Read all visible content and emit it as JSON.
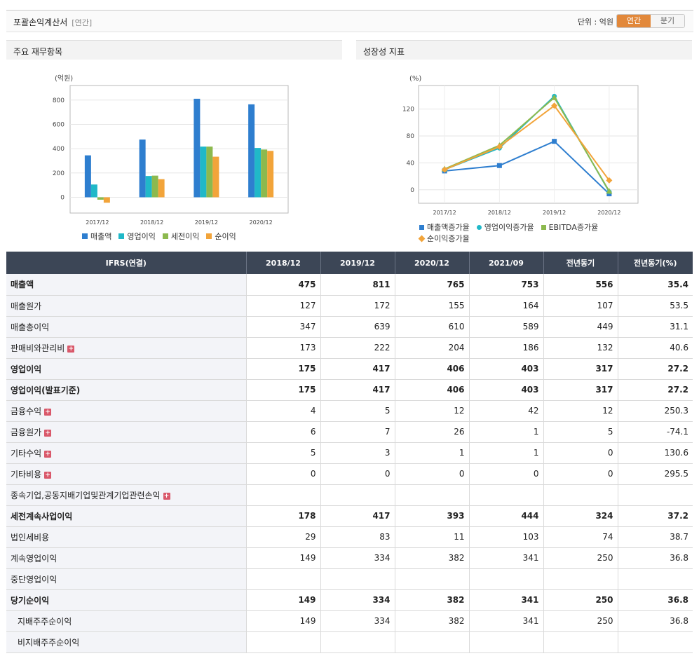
{
  "header": {
    "title": "포괄손익계산서",
    "period": "[연간]",
    "unit_label": "단위 : 억원",
    "tabs": [
      "연간",
      "분기"
    ]
  },
  "panels": {
    "left_title": "주요 재무항목",
    "right_title": "성장성 지표"
  },
  "colors": {
    "revenue": "#2e7ecf",
    "op_income": "#20b8c8",
    "pretax": "#8cb94e",
    "net": "#f2a43a",
    "header_bg": "#3c4656",
    "negative": "#e32c2c"
  },
  "chart_data": [
    {
      "type": "bar",
      "title": "주요 재무항목",
      "unit": "(억원)",
      "categories": [
        "2017/12",
        "2018/12",
        "2019/12",
        "2020/12"
      ],
      "series": [
        {
          "name": "매출액",
          "values": [
            345,
            475,
            811,
            765
          ]
        },
        {
          "name": "영업이익",
          "values": [
            105,
            175,
            417,
            406
          ]
        },
        {
          "name": "세전이익",
          "values": [
            -20,
            178,
            417,
            393
          ]
        },
        {
          "name": "순이익",
          "values": [
            -45,
            149,
            334,
            382
          ]
        }
      ],
      "yticks": [
        0,
        200,
        400,
        600,
        800
      ],
      "ylim": [
        -130,
        920
      ],
      "grid": true,
      "legend": "bottom"
    },
    {
      "type": "line",
      "title": "성장성 지표",
      "unit": "(%)",
      "categories": [
        "2017/12",
        "2018/12",
        "2019/12",
        "2020/12"
      ],
      "series": [
        {
          "name": "매출액증가율",
          "values": [
            28,
            36,
            72,
            -6
          ]
        },
        {
          "name": "영업이익증가율",
          "values": [
            30,
            62,
            139,
            -3
          ]
        },
        {
          "name": "EBITDA증가율",
          "values": [
            31,
            66,
            137,
            -2
          ]
        },
        {
          "name": "순이익증가율",
          "values": [
            30,
            64,
            125,
            14
          ]
        }
      ],
      "yticks": [
        0,
        40,
        80,
        120
      ],
      "ylim": [
        -20,
        155
      ],
      "grid": true,
      "legend": "bottom"
    }
  ],
  "table": {
    "columns": [
      "IFRS(연결)",
      "2018/12",
      "2019/12",
      "2020/12",
      "2021/09",
      "전년동기",
      "전년동기(%)"
    ],
    "rows": [
      {
        "label": "매출액",
        "values": [
          "475",
          "811",
          "765",
          "753",
          "556",
          "35.4"
        ],
        "bold": true
      },
      {
        "label": "매출원가",
        "values": [
          "127",
          "172",
          "155",
          "164",
          "107",
          "53.5"
        ]
      },
      {
        "label": "매출총이익",
        "values": [
          "347",
          "639",
          "610",
          "589",
          "449",
          "31.1"
        ]
      },
      {
        "label": "판매비와관리비",
        "values": [
          "173",
          "222",
          "204",
          "186",
          "132",
          "40.6"
        ],
        "plus": true
      },
      {
        "label": "영업이익",
        "values": [
          "175",
          "417",
          "406",
          "403",
          "317",
          "27.2"
        ],
        "bold": true,
        "group": true
      },
      {
        "label": "영업이익(발표기준)",
        "values": [
          "175",
          "417",
          "406",
          "403",
          "317",
          "27.2"
        ],
        "bold": true
      },
      {
        "label": "금융수익",
        "values": [
          "4",
          "5",
          "12",
          "42",
          "12",
          "250.3"
        ],
        "plus": true
      },
      {
        "label": "금융원가",
        "values": [
          "6",
          "7",
          "26",
          "1",
          "5",
          "-74.1"
        ],
        "plus": true
      },
      {
        "label": "기타수익",
        "values": [
          "5",
          "3",
          "1",
          "1",
          "0",
          "130.6"
        ],
        "plus": true
      },
      {
        "label": "기타비용",
        "values": [
          "0",
          "0",
          "0",
          "0",
          "0",
          "295.5"
        ],
        "plus": true
      },
      {
        "label": "종속기업,공동지배기업및관계기업관련손익",
        "values": [
          "",
          "",
          "",
          "",
          "",
          ""
        ],
        "plus": true
      },
      {
        "label": "세전계속사업이익",
        "values": [
          "178",
          "417",
          "393",
          "444",
          "324",
          "37.2"
        ],
        "bold": true,
        "group": true
      },
      {
        "label": "법인세비용",
        "values": [
          "29",
          "83",
          "11",
          "103",
          "74",
          "38.7"
        ]
      },
      {
        "label": "계속영업이익",
        "values": [
          "149",
          "334",
          "382",
          "341",
          "250",
          "36.8"
        ]
      },
      {
        "label": "중단영업이익",
        "values": [
          "",
          "",
          "",
          "",
          "",
          ""
        ]
      },
      {
        "label": "당기순이익",
        "values": [
          "149",
          "334",
          "382",
          "341",
          "250",
          "36.8"
        ],
        "bold": true
      },
      {
        "label": "지배주주순이익",
        "values": [
          "149",
          "334",
          "382",
          "341",
          "250",
          "36.8"
        ],
        "sub": true
      },
      {
        "label": "비지배주주순이익",
        "values": [
          "",
          "",
          "",
          "",
          "",
          ""
        ],
        "sub": true
      }
    ]
  }
}
